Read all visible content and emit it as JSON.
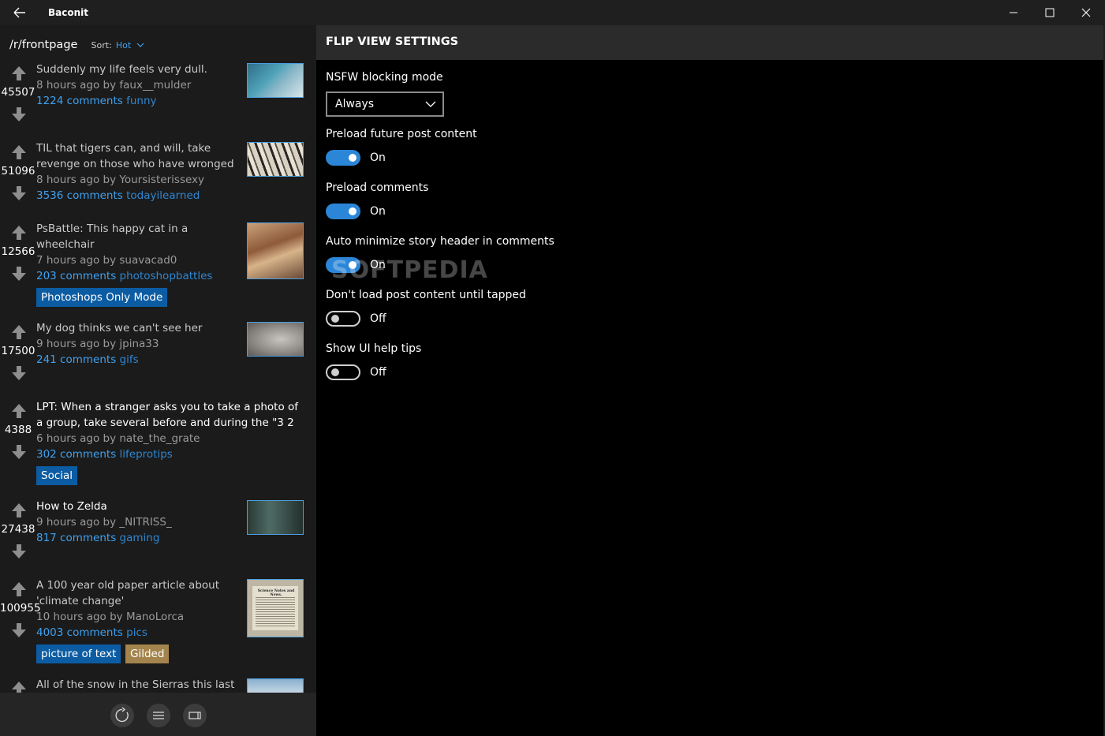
{
  "window": {
    "title": "Baconit"
  },
  "feed": {
    "subreddit": "/r/frontpage",
    "sort_label": "Sort:",
    "sort_value": "Hot",
    "posts": [
      {
        "score": "45507",
        "title_line1": "Suddenly my life feels very dull.",
        "title_line2": "",
        "meta": "8 hours ago by faux__mulder",
        "comments": "1224 comments",
        "subreddit": "funny",
        "flairs": []
      },
      {
        "score": "51096",
        "title_line1": "TIL that tigers can, and will, take",
        "title_line2": "revenge on those who have wronged",
        "meta": "8 hours ago by Yoursisterissexy",
        "comments": "3536 comments",
        "subreddit": "todayilearned",
        "flairs": []
      },
      {
        "score": "12566",
        "title_line1": "PsBattle: This happy cat in a",
        "title_line2": "wheelchair",
        "meta": "7 hours ago by suavacad0",
        "comments": "203 comments",
        "subreddit": "photoshopbattles",
        "flairs": [
          "Photoshops Only Mode"
        ]
      },
      {
        "score": "17500",
        "title_line1": "My dog thinks we can't see her",
        "title_line2": "",
        "meta": "9 hours ago by jpina33",
        "comments": "241 comments",
        "subreddit": "gifs",
        "flairs": []
      },
      {
        "score": "4388",
        "title_line1": "LPT: When a stranger asks you to take a photo of",
        "title_line2": "a group, take several before and during the \"3 2",
        "meta": "6 hours ago by nate_the_grate",
        "comments": "302 comments",
        "subreddit": "lifeprotips",
        "flairs": [
          "Social"
        ]
      },
      {
        "score": "27438",
        "title_line1": "How to Zelda",
        "title_line2": "",
        "meta": "9 hours ago by _NITRISS_",
        "comments": "817 comments",
        "subreddit": "gaming",
        "flairs": []
      },
      {
        "score": "100955",
        "title_line1": "A 100 year old paper article about",
        "title_line2": "'climate change'",
        "meta": "10 hours ago by ManoLorca",
        "comments": "4003 comments",
        "subreddit": "pics",
        "flairs": [
          "picture of text",
          "Gilded"
        ]
      },
      {
        "score": "",
        "title_line1": "All of the snow in the Sierras this last",
        "title_line2": "",
        "meta": "",
        "comments": "",
        "subreddit": "",
        "flairs": []
      }
    ],
    "thumbnail_texts": {
      "newspaper_headline": "Science Notes and News."
    }
  },
  "appbar": {
    "buttons": [
      "refresh-icon",
      "menu-icon",
      "flipview-icon"
    ]
  },
  "settings": {
    "header": "FLIP VIEW SETTINGS",
    "nsfw": {
      "label": "NSFW blocking mode",
      "value": "Always"
    },
    "toggles": [
      {
        "label": "Preload future post content",
        "state": "On"
      },
      {
        "label": "Preload comments",
        "state": "On"
      },
      {
        "label": "Auto minimize story header in comments",
        "state": "On"
      },
      {
        "label": "Don't load post content until tapped",
        "state": "Off"
      },
      {
        "label": "Show UI help tips",
        "state": "Off"
      }
    ],
    "watermark": "SOFTPEDIA"
  },
  "colors": {
    "accent": "#2b86d8",
    "link": "#3fa1f0",
    "flair": "#0c5ca3",
    "gilded": "#a4844d"
  }
}
